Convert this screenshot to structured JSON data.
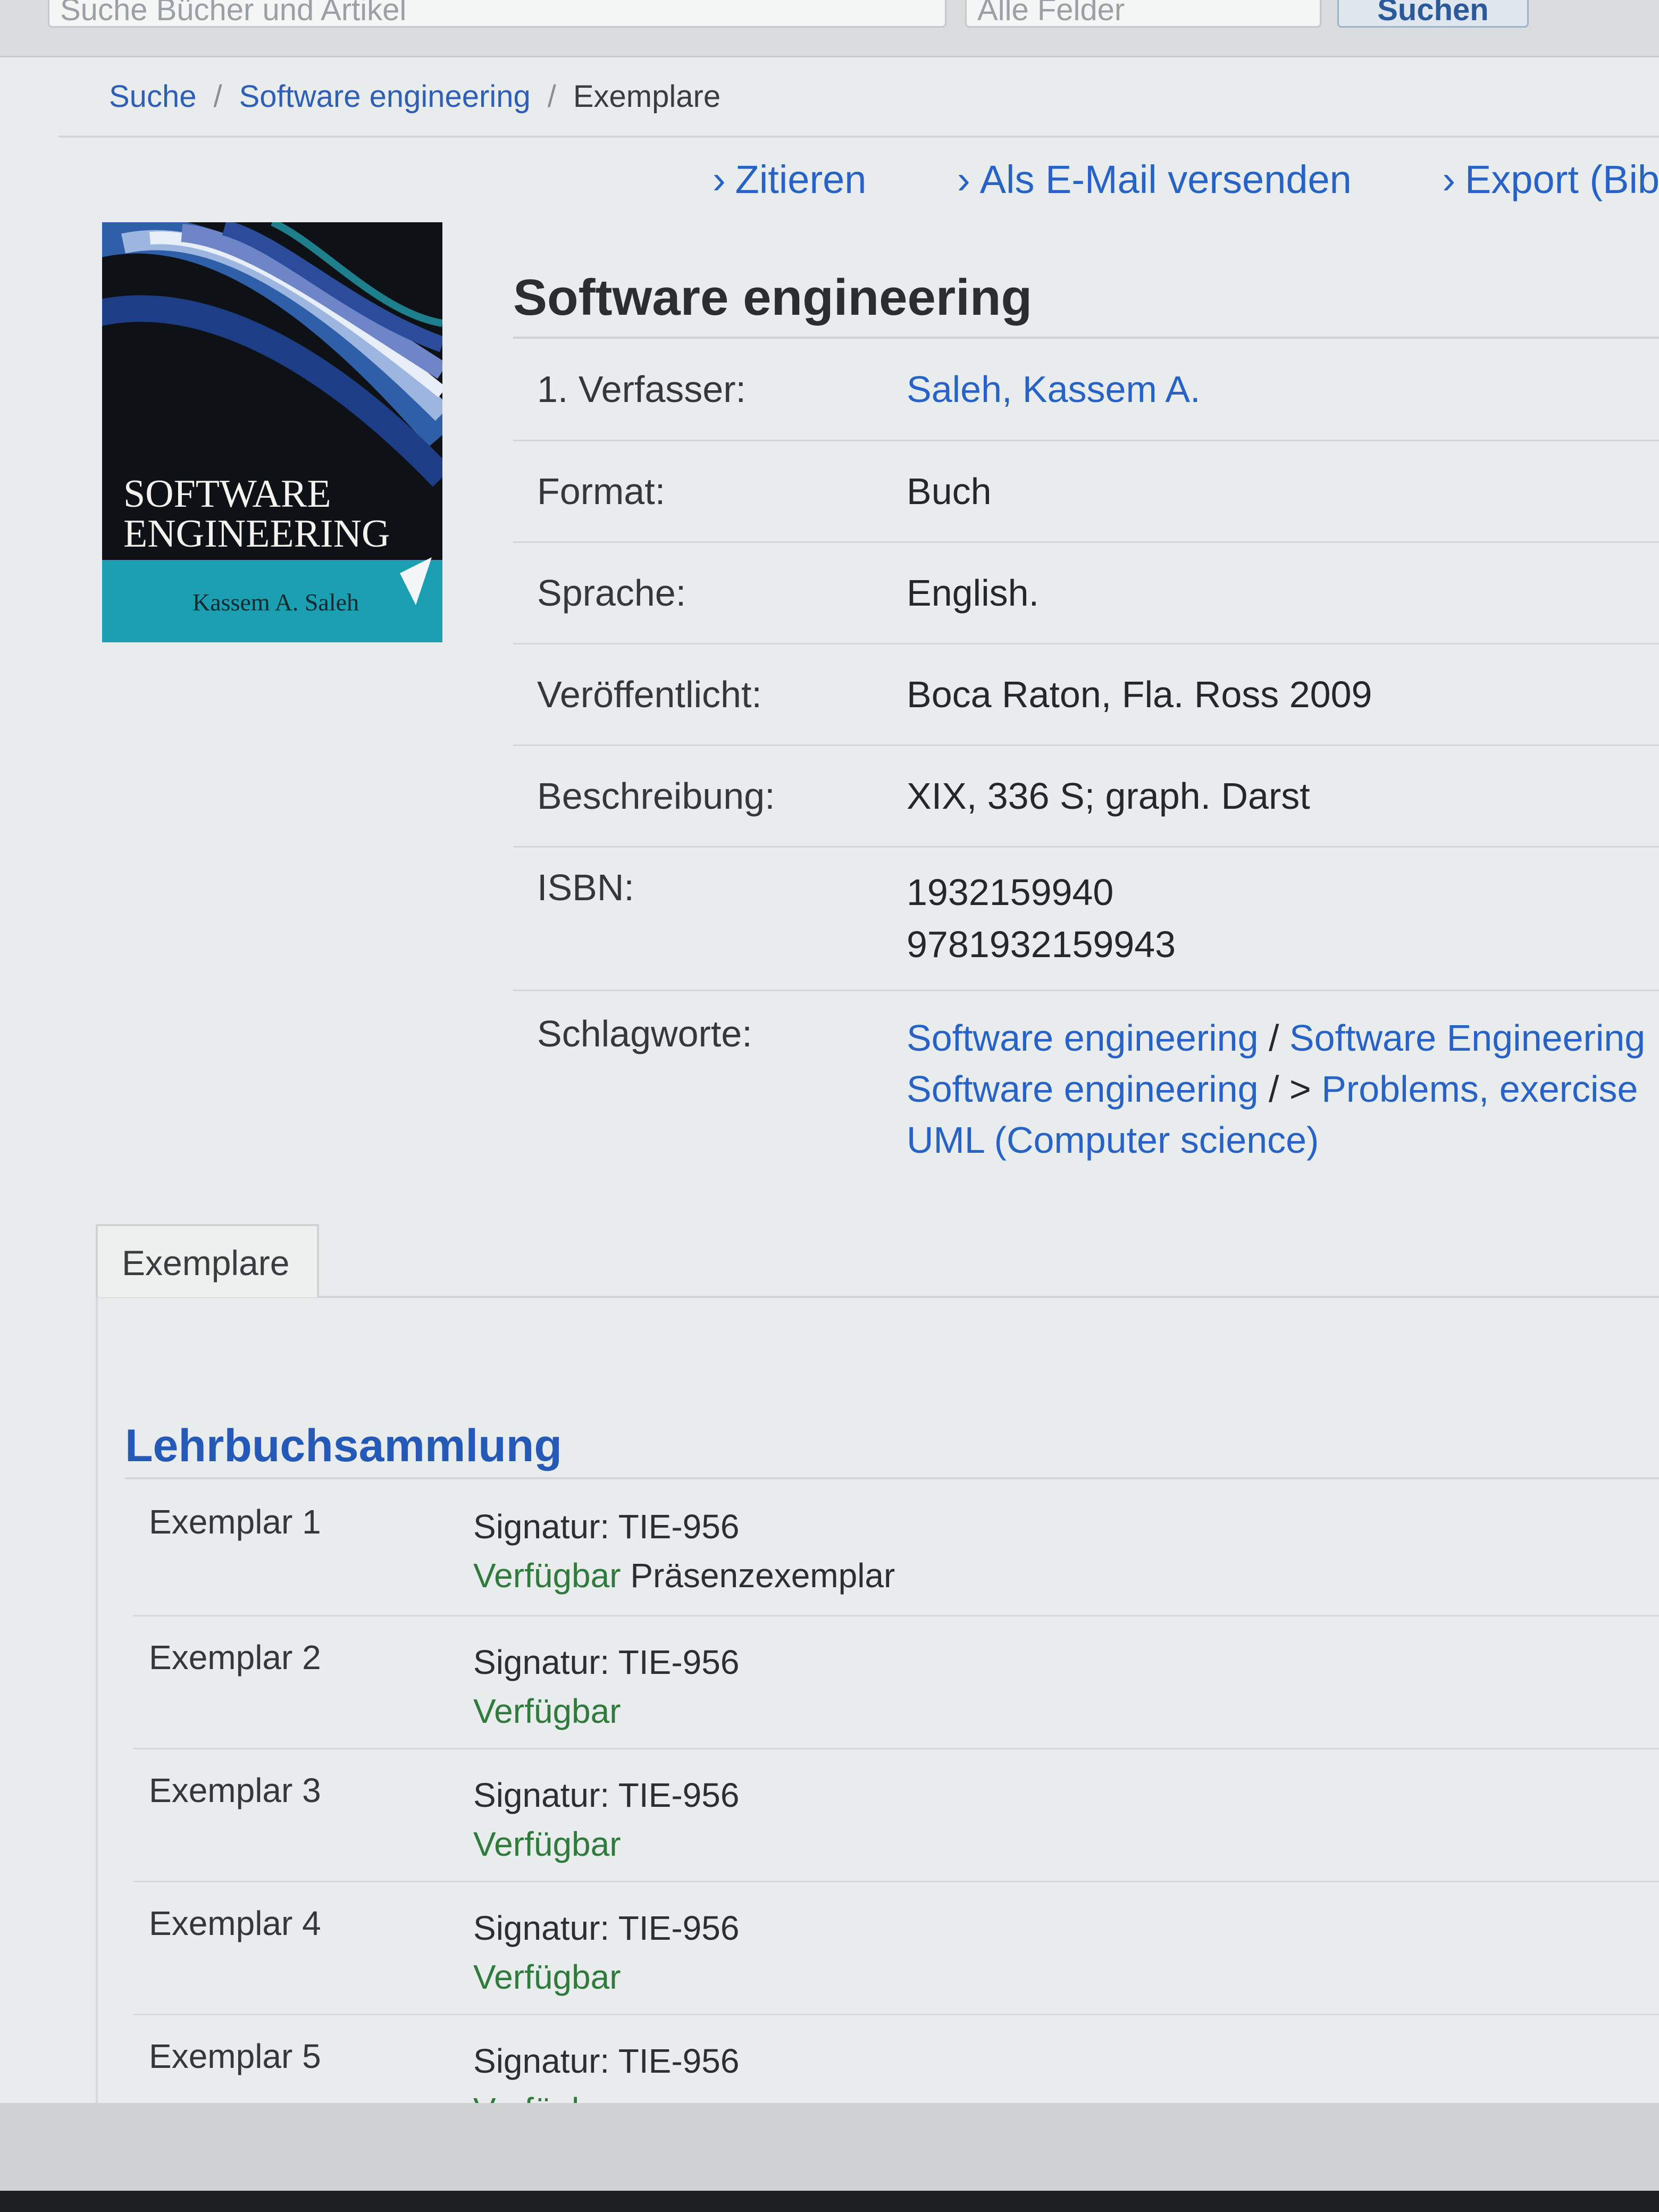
{
  "search": {
    "placeholder": "Suche Bücher und Artikel",
    "filter_value": "Alle Felder",
    "button_label": "Suchen"
  },
  "breadcrumb": [
    "Suche",
    "Software engineering",
    "Exemplare"
  ],
  "actions": [
    "Zitieren",
    "Als E-Mail versenden",
    "Export (Bib"
  ],
  "cover": {
    "title_line1": "SOFTWARE",
    "title_line2": "ENGINEERING",
    "author": "Kassem A. Saleh"
  },
  "record": {
    "title": "Software engineering",
    "fields": {
      "author_label": "1. Verfasser:",
      "author_value": "Saleh, Kassem A.",
      "format_label": "Format:",
      "format_value": "Buch",
      "language_label": "Sprache:",
      "language_value": "English.",
      "published_label": "Veröffentlicht:",
      "published_value": "Boca Raton, Fla. Ross 2009",
      "description_label": "Beschreibung:",
      "description_value": "XIX, 336 S; graph. Darst",
      "isbn_label": "ISBN:",
      "isbn_1": "1932159940",
      "isbn_2": "9781932159943",
      "subjects_label": "Schlagworte:",
      "subject_1a": "Software engineering",
      "subject_1sep": " / ",
      "subject_1b": "Software Engineering",
      "subject_2a": "Software engineering",
      "subject_2sep": " / > ",
      "subject_2b": "Problems, exercise",
      "subject_3": "UML (Computer science)"
    }
  },
  "tabs": {
    "active": "Exemplare"
  },
  "holdings": {
    "section_title": "Lehrbuchsammlung",
    "items": [
      {
        "name": "Exemplar 1",
        "signatur": "Signatur: TIE-956",
        "status": "Verfügbar",
        "note": " Präsenzexemplar"
      },
      {
        "name": "Exemplar 2",
        "signatur": "Signatur: TIE-956",
        "status": "Verfügbar",
        "note": ""
      },
      {
        "name": "Exemplar 3",
        "signatur": "Signatur: TIE-956",
        "status": "Verfügbar",
        "note": ""
      },
      {
        "name": "Exemplar 4",
        "signatur": "Signatur: TIE-956",
        "status": "Verfügbar",
        "note": ""
      },
      {
        "name": "Exemplar 5",
        "signatur": "Signatur: TIE-956",
        "status": "Verfügbar",
        "note": ""
      }
    ]
  },
  "colors": {
    "link": "#2762c6",
    "available": "#2f7a3c",
    "section": "#2559b8"
  }
}
